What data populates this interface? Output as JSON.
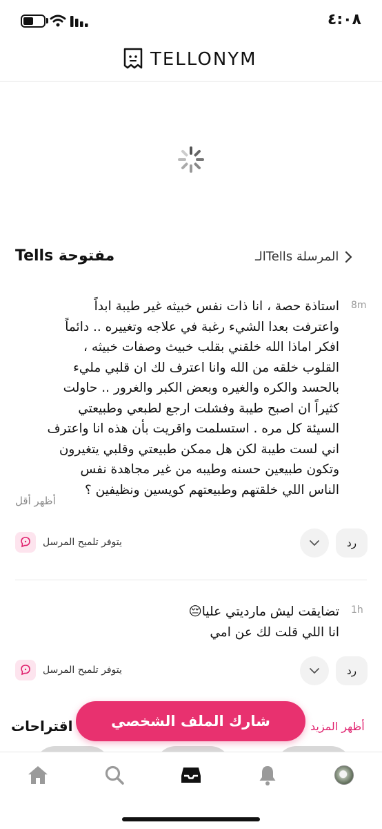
{
  "status_bar": {
    "time": "٤:٠٨"
  },
  "header": {
    "logo_text": "TELLONYM"
  },
  "section": {
    "title": "Tells مفتوحة",
    "sent_link": "الـTells المرسلة"
  },
  "tells": [
    {
      "time": "8m",
      "lines": [
        "استاذة حصة ، انا ذات نفس خبيثه غير طيبة ابداً",
        "واعترفت بعدا الشيء رغبة في علاجه وتغييره .. دائماً",
        "افكر اماذا الله خلقني بقلب خبيث وصفات خبيثه ،",
        "القلوب خلقه من الله وانا اعترف لك ان قلبي مليء",
        "بالحسد والكره والغيره وبعض الكبر والغرور .. حاولت",
        "كثيراً ان اصبح طيبة وفشلت ارجع لطبعي وطبيعتي",
        "السيئة كل مره . استسلمت واقريت بأن هذه انا واعترف",
        "اني لست طيبة لكن هل ممكن طبيعتي وقلبي يتغيرون",
        "وتكون طبيعين حسنه وطيبه من غير مجاهدة نفس",
        "الناس اللي خلقتهم وطبيعتهم كويسين ونظيفين ؟"
      ],
      "show_less": "أظهر أقل",
      "hint": "يتوفر تلميح المرسل",
      "reply": "رد"
    },
    {
      "time": "1h",
      "lines": [
        "تضايقت ليش مارديتي عليا😔",
        "انا اللي قلت لك عن امي"
      ],
      "hint": "يتوفر تلميح المرسل",
      "reply": "رد"
    }
  ],
  "suggestions": {
    "title": "اقتراحات",
    "show_more": "أظهر المزيد"
  },
  "share_button": "شارك الملف الشخصي",
  "nav": {
    "items": [
      "home-icon",
      "search-icon",
      "inbox-icon",
      "bell-icon",
      "avatar"
    ]
  },
  "colors": {
    "accent": "#e8316f",
    "accent_light": "#fde4ee"
  }
}
